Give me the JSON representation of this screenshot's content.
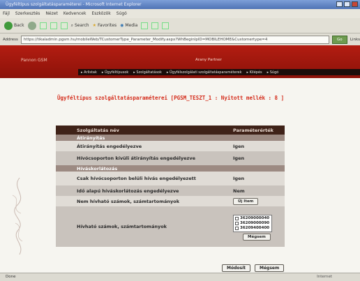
{
  "window": {
    "title": "Ügyféltípus szolgáltatásparaméterei - Microsoft Internet Explorer"
  },
  "menu": [
    "Fájl",
    "Szerkesztés",
    "Nézet",
    "Kedvencek",
    "Eszközök",
    "Súgó"
  ],
  "toolbar": {
    "back_label": "Back",
    "search_label": "Search",
    "favorites_label": "Favorites",
    "media_label": "Media"
  },
  "address": {
    "label": "Address",
    "url": "https://tikaladmin.pgsm.hu/mobileWeb/TCustomerType_Parameter_Modify.aspx?WhBeginIpID=MOBILEHOME&Customertype=4",
    "go_label": "Go",
    "links_label": "Links"
  },
  "site": {
    "logo_text": "Pannon GSM",
    "title": "Arany Partner",
    "nav": [
      "Arlistak",
      "Ügyféltípusok",
      "Szolgáltatások",
      "Ügyfélszolgálati szolgáltatásparaméterek",
      "Kilépés",
      "Súgó"
    ]
  },
  "page_title": "Ügyféltípus szolgáltatásparaméterei [PGSM_TESZT_1 : Nyitott mellék : 8 ]",
  "table": {
    "col_name": "Szolgáltatás név",
    "col_value": "Paraméterérték",
    "sections": [
      {
        "title": "Átirányítás",
        "rows": [
          {
            "name": "Átirányítás engedélyezve",
            "value": "Igen"
          },
          {
            "name": "Hívócsoporton kívüli átirányítás engedélyezve",
            "value": "Igen"
          }
        ]
      },
      {
        "title": "Híváskorlátozás",
        "rows": [
          {
            "name": "Csak hívócsoporton belüli hívás engedélyezett",
            "value": "Igen"
          },
          {
            "name": "Idő alapú híváskorlátozás engedélyezve",
            "value": "Nem"
          }
        ]
      }
    ],
    "row_not_callable": {
      "name": "Nem hívható számok, számtartományok",
      "button": "Új Item"
    },
    "row_callable": {
      "name": "Hívható számok, számtartományok",
      "items": [
        "36209000040",
        "36209000090",
        "36209400400"
      ],
      "delete_button": "Mégsem"
    }
  },
  "buttons": {
    "modify": "Módosít",
    "cancel": "Mégsem"
  },
  "status": {
    "left": "Done",
    "right": "Internet"
  }
}
